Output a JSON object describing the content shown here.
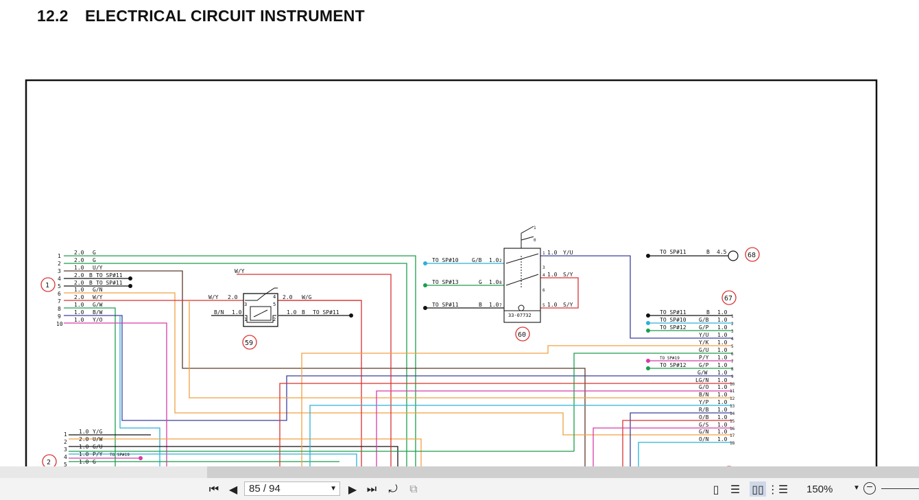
{
  "document": {
    "section_number": "12.2",
    "section_title": "ELECTRICAL CIRCUIT INSTRUMENT"
  },
  "diagram": {
    "components": {
      "c1": "1",
      "c2": "2",
      "c59": "59",
      "c60": "60",
      "c67": "67",
      "c68": "68",
      "part60": "33-07732"
    },
    "connector1": [
      {
        "pin": "1",
        "size": "2.0",
        "color": "G",
        "note": ""
      },
      {
        "pin": "2",
        "size": "2.0",
        "color": "G",
        "note": ""
      },
      {
        "pin": "3",
        "size": "1.0",
        "color": "U/Y",
        "note": ""
      },
      {
        "pin": "4",
        "size": "2.0",
        "color": "B",
        "note": "TO SP#11"
      },
      {
        "pin": "5",
        "size": "2.0",
        "color": "B",
        "note": "TO SP#11"
      },
      {
        "pin": "6",
        "size": "1.0",
        "color": "G/N",
        "note": ""
      },
      {
        "pin": "7",
        "size": "2.0",
        "color": "W/Y",
        "note": ""
      },
      {
        "pin": "8",
        "size": "1.0",
        "color": "G/W",
        "note": ""
      },
      {
        "pin": "9",
        "size": "1.0",
        "color": "B/W",
        "note": ""
      },
      {
        "pin": "10",
        "size": "1.0",
        "color": "Y/O",
        "note": ""
      }
    ],
    "connector2": [
      {
        "pin": "1",
        "size": "1.0",
        "color": "Y/G",
        "note": ""
      },
      {
        "pin": "2",
        "size": "2.0",
        "color": "U/W",
        "note": ""
      },
      {
        "pin": "3",
        "size": "1.0",
        "color": "G/U",
        "note": ""
      },
      {
        "pin": "4",
        "size": "1.0",
        "color": "P/Y",
        "note": "TO SP#19"
      },
      {
        "pin": "5",
        "size": "1.0",
        "color": "G",
        "note": ""
      }
    ],
    "relay59": {
      "w_y_top": "W/Y",
      "w_y_left": "W/Y",
      "w_y_size": "2.0",
      "w_g": "W/G",
      "w_g_size": "2.0",
      "b_n": "B/N",
      "b_n_size": "1.0",
      "b_size": "1.0",
      "b": "B",
      "to_sp11": "TO SP#11",
      "pin3": "3",
      "pin4": "4",
      "pin5": "5",
      "pin1": "1",
      "pin2": "2"
    },
    "switch60": {
      "sp10": "TO SP#10",
      "gb": "G/B",
      "gb_size": "1.0",
      "pin2": "2",
      "sp13": "TO SP#13",
      "g": "G",
      "g_size": "1.0",
      "pin8": "8",
      "sp11": "TO SP#11",
      "b": "B",
      "b_size": "1.0",
      "pin7": "7",
      "out1": "1",
      "out1_size": "1.0",
      "yu": "Y/U",
      "out3": "3",
      "out4": "4",
      "out4_size": "1.0",
      "sy1": "S/Y",
      "out6": "6",
      "out5": "5",
      "out5_size": "1.0",
      "sy2": "S/Y",
      "lever1": "1",
      "lever0": "0"
    },
    "item68": {
      "sp": "TO SP#11",
      "color": "B",
      "size": "4.5"
    },
    "connector67": [
      {
        "pin": "1",
        "note": "TO SP#11",
        "color": "B",
        "size": "1.0"
      },
      {
        "pin": "2",
        "note": "TO SP#10",
        "color": "G/B",
        "size": "1.0"
      },
      {
        "pin": "3",
        "note": "TO SP#12",
        "color": "G/P",
        "size": "1.0"
      },
      {
        "pin": "4",
        "note": "",
        "color": "Y/U",
        "size": "1.0"
      },
      {
        "pin": "5",
        "note": "",
        "color": "Y/K",
        "size": "1.0"
      },
      {
        "pin": "6",
        "note": "",
        "color": "G/U",
        "size": "1.0"
      },
      {
        "pin": "7",
        "note": "TO SP#19",
        "color": "P/Y",
        "size": "1.0"
      },
      {
        "pin": "8",
        "note": "TO SP#12",
        "color": "G/P",
        "size": "1.0"
      },
      {
        "pin": "9",
        "note": "",
        "color": "G/W",
        "size": "1.0"
      },
      {
        "pin": "10",
        "note": "",
        "color": "LG/N",
        "size": "1.0"
      },
      {
        "pin": "11",
        "note": "",
        "color": "G/O",
        "size": "1.0"
      },
      {
        "pin": "12",
        "note": "",
        "color": "B/N",
        "size": "1.0"
      },
      {
        "pin": "13",
        "note": "",
        "color": "Y/P",
        "size": "1.0"
      },
      {
        "pin": "14",
        "note": "",
        "color": "R/B",
        "size": "1.0"
      },
      {
        "pin": "15",
        "note": "",
        "color": "O/B",
        "size": "1.0"
      },
      {
        "pin": "16",
        "note": "",
        "color": "G/S",
        "size": "1.0"
      },
      {
        "pin": "17",
        "note": "",
        "color": "G/N",
        "size": "1.0"
      },
      {
        "pin": "18",
        "note": "",
        "color": "O/N",
        "size": "1.0"
      }
    ],
    "wire_colors": {
      "green": "#1a9e4a",
      "blue": "#3b3f9e",
      "orange": "#f0a040",
      "red": "#d93030",
      "magenta": "#d83aa8",
      "cyan": "#2ab0d8",
      "black": "#111111",
      "brown": "#5a3a2a"
    }
  },
  "toolbar": {
    "page_value": "85 / 94",
    "zoom_value": "150%",
    "icons": [
      "first-page-icon",
      "prev-page-icon",
      "next-page-icon",
      "last-page-icon",
      "rotate-icon",
      "fit-icon",
      "single-page-icon",
      "scroll-icon",
      "two-page-icon",
      "split-icon",
      "zoom-out-icon"
    ]
  }
}
